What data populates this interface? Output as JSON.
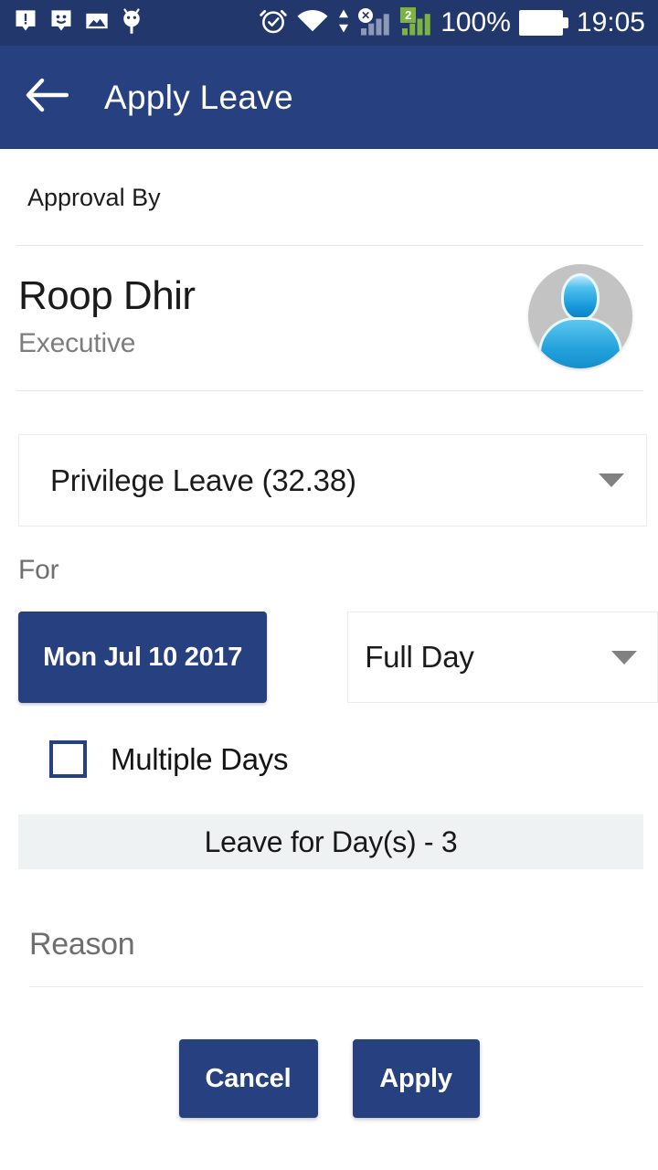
{
  "status_bar": {
    "icons_left": [
      "alert-bubble-icon",
      "smiley-bubble-icon",
      "photo-icon",
      "android-robot-icon"
    ],
    "icons_right": [
      "alarm-clock-icon",
      "wifi-icon",
      "data-transfer-icon",
      "signal-sim1-disabled-icon",
      "signal-sim2-icon"
    ],
    "sim2_badge": "2",
    "nosim_mark": "x",
    "battery_percent": "100%",
    "time": "19:05",
    "background_color": "#22376b"
  },
  "app_bar": {
    "back_icon": "arrow-left-icon",
    "title": "Apply Leave",
    "background_color": "#27407f"
  },
  "approval": {
    "section_label": "Approval By",
    "name": "Roop Dhir",
    "role": "Executive",
    "avatar_icon": "person-avatar-icon"
  },
  "leave_type": {
    "selected": "Privilege Leave (32.38)",
    "caret_icon": "chevron-down-icon"
  },
  "for_section": {
    "label": "For",
    "date": "Mon Jul 10 2017",
    "duration": "Full Day",
    "duration_caret_icon": "chevron-down-icon"
  },
  "multiple_days": {
    "label": "Multiple Days",
    "checked": false
  },
  "days_banner": {
    "text": "Leave for Day(s) - 3",
    "background_color": "#eef2f3"
  },
  "reason": {
    "value": "",
    "placeholder": "Reason"
  },
  "footer": {
    "cancel_label": "Cancel",
    "apply_label": "Apply",
    "button_color": "#27407f"
  }
}
